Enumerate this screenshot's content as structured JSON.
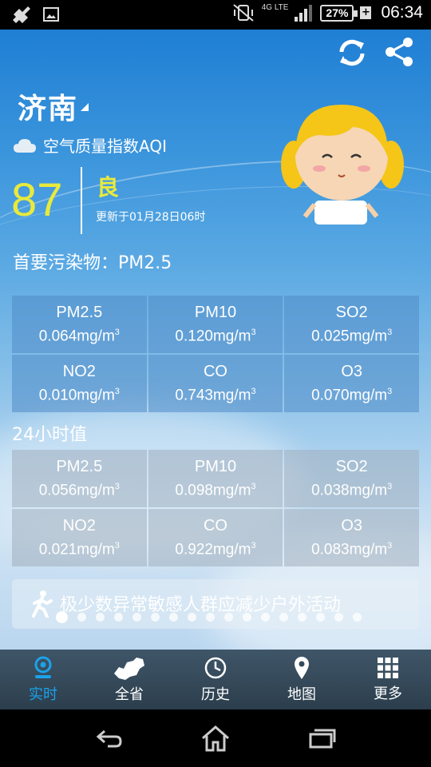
{
  "status_bar": {
    "network": "4G LTE",
    "battery": "27%",
    "time": "06:34"
  },
  "header": {
    "city": "济南",
    "aqi_title": "空气质量指数AQI"
  },
  "aqi": {
    "value": "87",
    "level": "良",
    "update_text": "更新于01月28日06时",
    "primary_pollutant": "首要污染物：PM2.5"
  },
  "current": {
    "items": [
      {
        "name": "PM2.5",
        "value": "0.064",
        "unit": "mg/m",
        "sup": "3"
      },
      {
        "name": "PM10",
        "value": "0.120",
        "unit": "mg/m",
        "sup": "3"
      },
      {
        "name": "SO2",
        "value": "0.025",
        "unit": "mg/m",
        "sup": "3"
      },
      {
        "name": "NO2",
        "value": "0.010",
        "unit": "mg/m",
        "sup": "3"
      },
      {
        "name": "CO",
        "value": "0.743",
        "unit": "mg/m",
        "sup": "3"
      },
      {
        "name": "O3",
        "value": "0.070",
        "unit": "mg/m",
        "sup": "3"
      }
    ]
  },
  "hour24": {
    "label": "24小时值",
    "items": [
      {
        "name": "PM2.5",
        "value": "0.056",
        "unit": "mg/m",
        "sup": "3"
      },
      {
        "name": "PM10",
        "value": "0.098",
        "unit": "mg/m",
        "sup": "3"
      },
      {
        "name": "SO2",
        "value": "0.038",
        "unit": "mg/m",
        "sup": "3"
      },
      {
        "name": "NO2",
        "value": "0.021",
        "unit": "mg/m",
        "sup": "3"
      },
      {
        "name": "CO",
        "value": "0.922",
        "unit": "mg/m",
        "sup": "3"
      },
      {
        "name": "O3",
        "value": "0.083",
        "unit": "mg/m",
        "sup": "3"
      }
    ]
  },
  "advice": {
    "text": "极少数异常敏感人群应减少户外活动"
  },
  "pager": {
    "count": 17,
    "active": 0
  },
  "nav": {
    "items": [
      {
        "label": "实时",
        "icon": "realtime-icon",
        "active": true
      },
      {
        "label": "全省",
        "icon": "province-map-icon",
        "active": false
      },
      {
        "label": "历史",
        "icon": "history-clock-icon",
        "active": false
      },
      {
        "label": "地图",
        "icon": "location-pin-icon",
        "active": false
      },
      {
        "label": "更多",
        "icon": "grid-more-icon",
        "active": false
      }
    ]
  },
  "colors": {
    "aqi_accent": "#e8ea3c",
    "nav_active": "#1aa3ea"
  }
}
